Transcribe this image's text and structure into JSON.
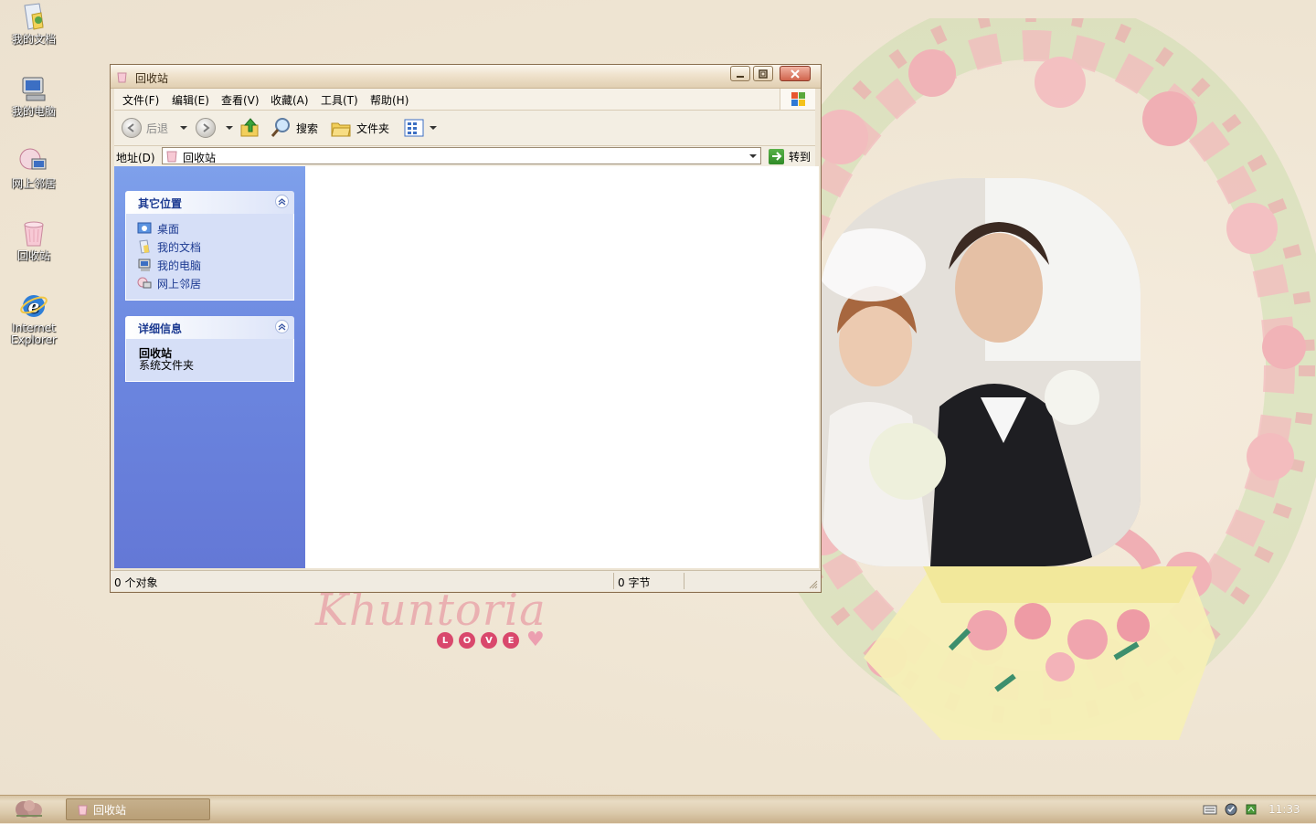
{
  "desktop": {
    "icons": [
      {
        "label": "我的文档",
        "icon": "my-documents-icon"
      },
      {
        "label": "我的电脑",
        "icon": "my-computer-icon"
      },
      {
        "label": "网上邻居",
        "icon": "network-places-icon"
      },
      {
        "label": "回收站",
        "icon": "recycle-bin-icon"
      },
      {
        "label": "Internet Explorer",
        "icon": "internet-explorer-icon"
      }
    ],
    "wallpaper_text": {
      "love_letters": [
        "L",
        "O",
        "V",
        "E"
      ]
    }
  },
  "window": {
    "title": "回收站",
    "menu": [
      "文件(F)",
      "编辑(E)",
      "查看(V)",
      "收藏(A)",
      "工具(T)",
      "帮助(H)"
    ],
    "toolbar": {
      "back": "后退",
      "search": "搜索",
      "folders": "文件夹"
    },
    "address": {
      "label": "地址(D)",
      "value": "回收站",
      "go": "转到"
    },
    "left_pane": {
      "other_places": {
        "title": "其它位置",
        "links": [
          "桌面",
          "我的文档",
          "我的电脑",
          "网上邻居"
        ]
      },
      "details": {
        "title": "详细信息",
        "name": "回收站",
        "type": "系统文件夹"
      }
    },
    "status": {
      "objects": "0 个对象",
      "size": "0 字节"
    }
  },
  "taskbar": {
    "task_label": "回收站",
    "clock": "11:33"
  },
  "colors": {
    "left_pane_top": "#7ea0eb",
    "left_pane_bottom": "#6478d6",
    "panel_title": "#1c3a91",
    "taskbar": "#d6c3a3"
  }
}
